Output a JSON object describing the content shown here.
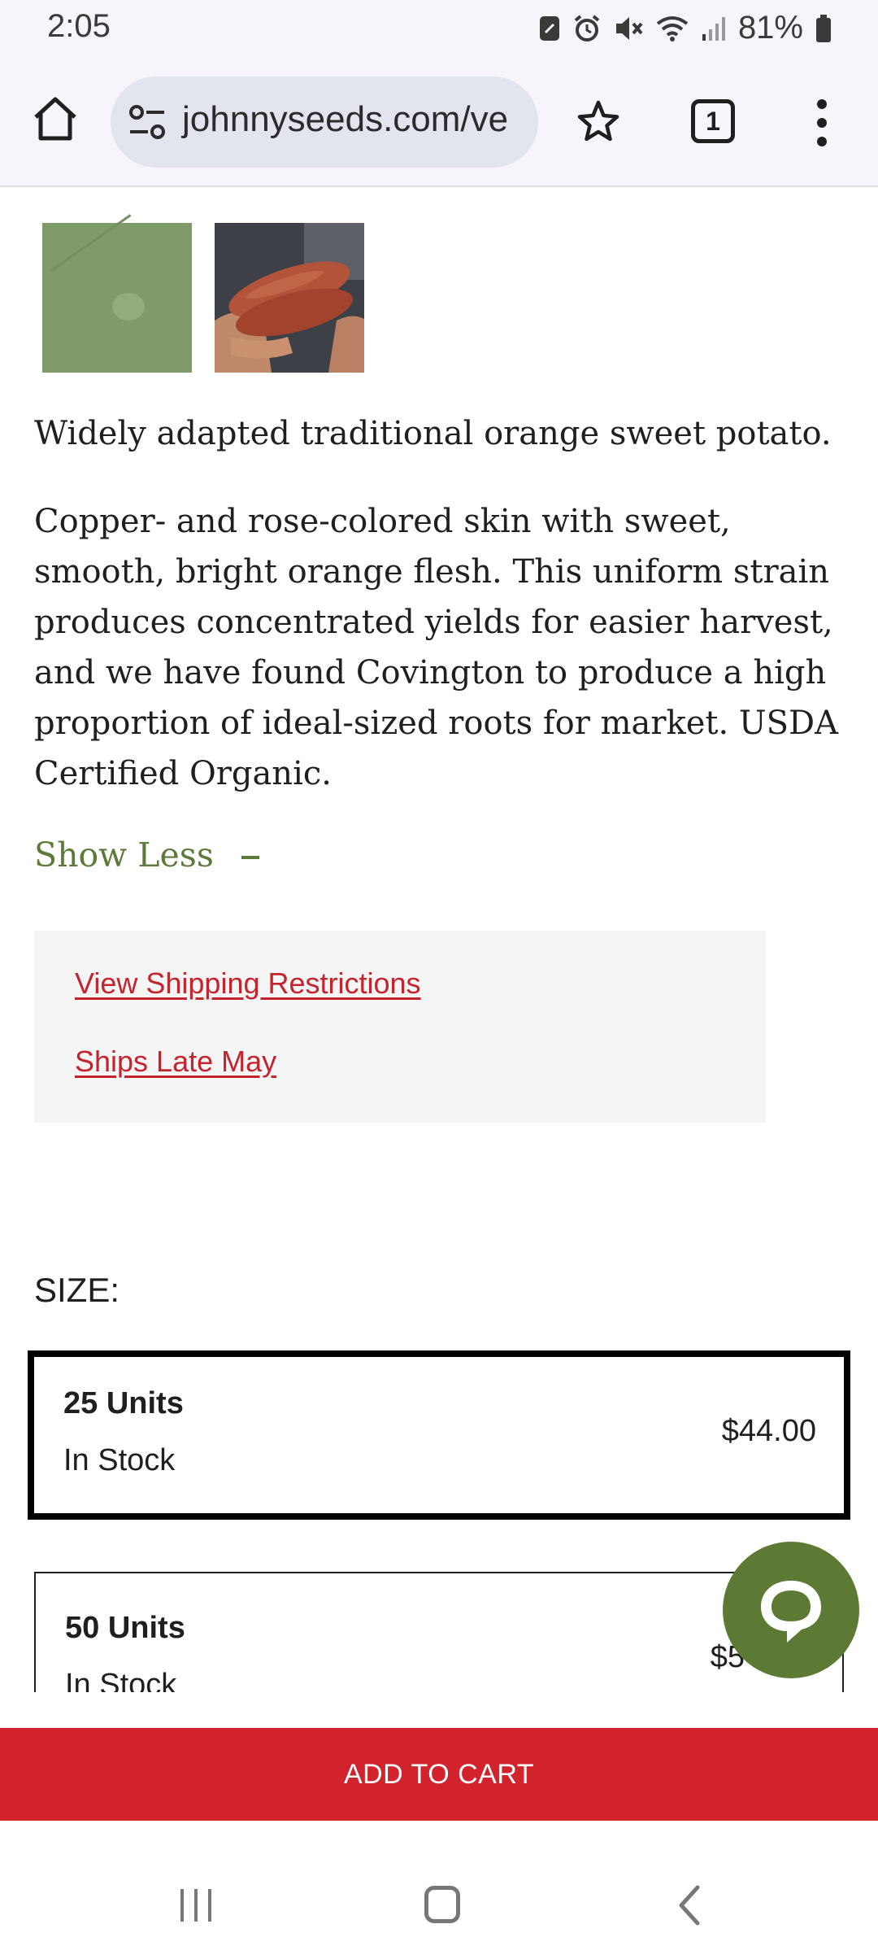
{
  "status_bar": {
    "time": "2:05",
    "battery": "81%"
  },
  "browser": {
    "url": "johnnyseeds.com/ve",
    "tab_count": "1"
  },
  "product": {
    "images": [
      {
        "name": "green leaf sample"
      },
      {
        "name": "sweet potatoes held in hands"
      }
    ],
    "short_description": "Widely adapted traditional orange sweet potato.",
    "long_description": "Copper- and rose-colored skin with sweet, smooth, bright orange flesh. This uniform strain produces concentrated yields for easier harvest, and we have found Covington to produce a high proportion of ideal-sized roots for market. USDA Certified Organic.",
    "show_less_label": "Show Less"
  },
  "shipping": {
    "restrictions_link": "View Shipping Restrictions",
    "ships_link": "Ships Late May"
  },
  "size": {
    "label": "SIZE:",
    "options": [
      {
        "name": "25 Units",
        "stock": "In Stock",
        "price": "$44.00",
        "selected": true
      },
      {
        "name": "50 Units",
        "stock": "In Stock",
        "price": "$5",
        "selected": false
      }
    ]
  },
  "cart": {
    "button_label": "ADD TO CART"
  },
  "colors": {
    "accent_red": "#d2232c",
    "brand_green": "#5d7a34",
    "link_red": "#c4242e"
  },
  "icons": [
    "home-icon",
    "site-settings-icon",
    "bookmark-star-icon",
    "tabs-icon",
    "more-menu-icon",
    "chat-icon",
    "recent-apps-icon",
    "nav-home-icon",
    "back-icon"
  ]
}
